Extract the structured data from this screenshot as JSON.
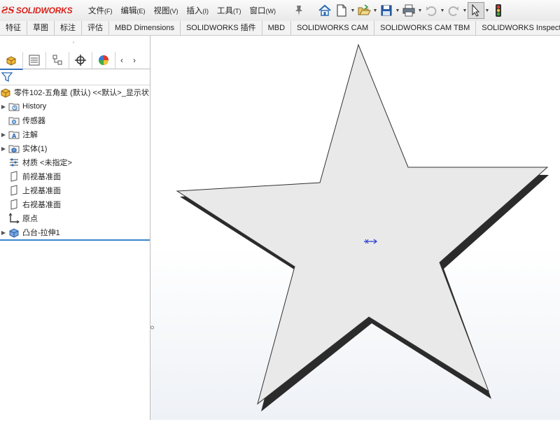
{
  "app": {
    "brand": "SOLIDWORKS"
  },
  "menu": [
    {
      "label": "文件",
      "key": "(F)"
    },
    {
      "label": "编辑",
      "key": "(E)"
    },
    {
      "label": "视图",
      "key": "(V)"
    },
    {
      "label": "插入",
      "key": "(I)"
    },
    {
      "label": "工具",
      "key": "(T)"
    },
    {
      "label": "窗口",
      "key": "(W)"
    }
  ],
  "toolbar": {
    "icons": [
      "home-icon",
      "new-document-icon",
      "open-icon",
      "save-icon",
      "print-icon",
      "undo-icon",
      "redo-icon",
      "select-cursor-icon",
      "traffic-light-icon"
    ]
  },
  "command_tabs": [
    "特征",
    "草图",
    "标注",
    "评估",
    "MBD Dimensions",
    "SOLIDWORKS 插件",
    "MBD",
    "SOLIDWORKS CAM",
    "SOLIDWORKS CAM TBM",
    "SOLIDWORKS Inspect"
  ],
  "tree": {
    "root": "零件102-五角星 (默认) <<默认>_显示状",
    "items": [
      {
        "label": "History",
        "icon": "history-folder-icon",
        "expandable": true
      },
      {
        "label": "传感器",
        "icon": "sensor-icon",
        "expandable": false
      },
      {
        "label": "注解",
        "icon": "annotation-icon",
        "expandable": true
      },
      {
        "label": "实体(1)",
        "icon": "solid-bodies-icon",
        "expandable": true
      },
      {
        "label": "材质 <未指定>",
        "icon": "material-icon",
        "expandable": false
      },
      {
        "label": "前视基准面",
        "icon": "plane-icon",
        "expandable": false
      },
      {
        "label": "上视基准面",
        "icon": "plane-icon",
        "expandable": false
      },
      {
        "label": "右视基准面",
        "icon": "plane-icon",
        "expandable": false
      },
      {
        "label": "原点",
        "icon": "origin-icon",
        "expandable": false
      },
      {
        "label": "凸台-拉伸1",
        "icon": "boss-extrude-icon",
        "expandable": true
      }
    ]
  },
  "colors": {
    "accent": "#2d6fbd",
    "brand_red": "#d8231c",
    "star_fill": "#e9e9e9",
    "star_edge": "#2b2b2b"
  }
}
